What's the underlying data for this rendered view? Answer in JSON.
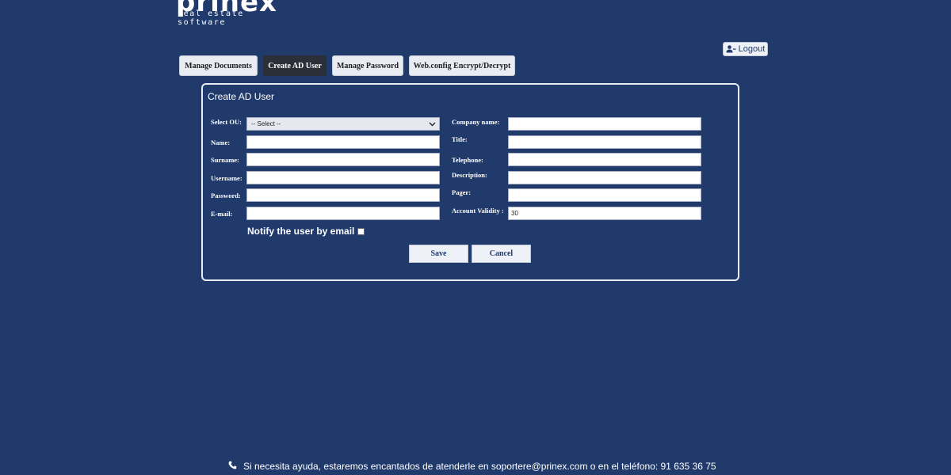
{
  "brand": {
    "logo_word": "prinex",
    "logo_tagline": "real estate software"
  },
  "header": {
    "logout_label": "Logout",
    "logout_icon": "user-logout-icon"
  },
  "tabs": [
    {
      "label": "Manage Documents",
      "active": false
    },
    {
      "label": "Create AD User",
      "active": true
    },
    {
      "label": "Manage Password",
      "active": false
    },
    {
      "label": "Web.config Encrypt/Decrypt",
      "active": false
    }
  ],
  "form": {
    "title": "Create AD User",
    "left": {
      "ou_label": "Select OU:",
      "ou_selected": "-- Select --",
      "name_label": "Name:",
      "surname_label": "Surname:",
      "username_label": "Username:",
      "password_label": "Password:",
      "email_label": "E-mail:"
    },
    "right": {
      "company_label": "Company name:",
      "title_label": "Title:",
      "telephone_label": "Telephone:",
      "description_label": "Description:",
      "pager_label": "Pager:",
      "validity_label": "Account Validity :",
      "validity_value": "30"
    },
    "notify_label": "Notify the user by email",
    "notify_checked": false,
    "save_label": "Save",
    "cancel_label": "Cancel"
  },
  "footer": {
    "text": "Si necesita ayuda, estaremos encantados de atenderle en soportere@prinex.com o en el teléfono: 91 635 36 75",
    "icon": "phone-icon"
  },
  "colors": {
    "background": "#213a6c",
    "active_tab": "#2b2f38"
  }
}
